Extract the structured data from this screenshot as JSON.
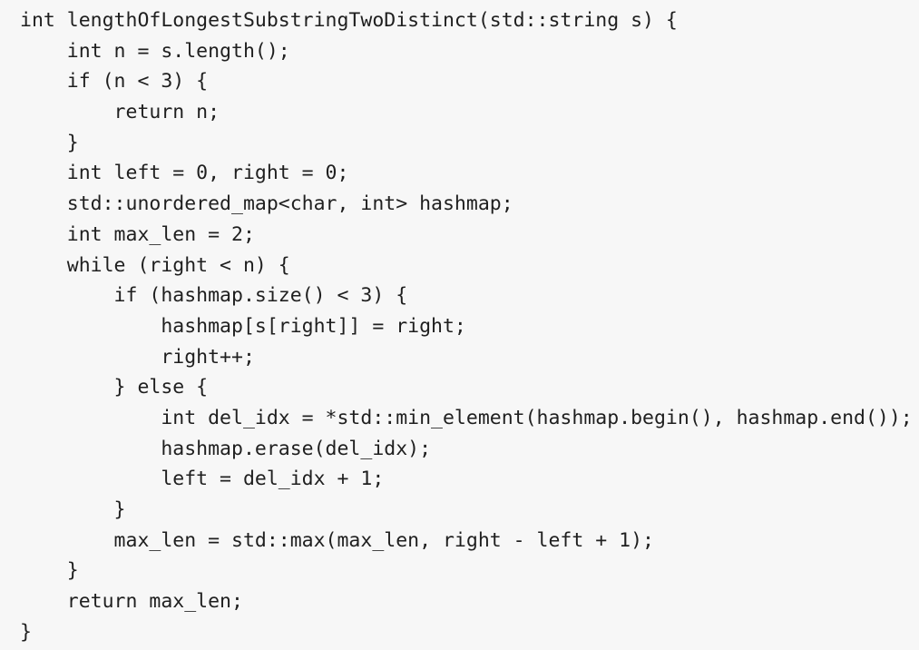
{
  "code": {
    "lines": [
      "int lengthOfLongestSubstringTwoDistinct(std::string s) {",
      "    int n = s.length();",
      "    if (n < 3) {",
      "        return n;",
      "    }",
      "    int left = 0, right = 0;",
      "    std::unordered_map<char, int> hashmap;",
      "    int max_len = 2;",
      "    while (right < n) {",
      "        if (hashmap.size() < 3) {",
      "            hashmap[s[right]] = right;",
      "            right++;",
      "        } else {",
      "            int del_idx = *std::min_element(hashmap.begin(), hashmap.end());",
      "            hashmap.erase(del_idx);",
      "            left = del_idx + 1;",
      "        }",
      "        max_len = std::max(max_len, right - left + 1);",
      "    }",
      "    return max_len;",
      "}"
    ]
  }
}
